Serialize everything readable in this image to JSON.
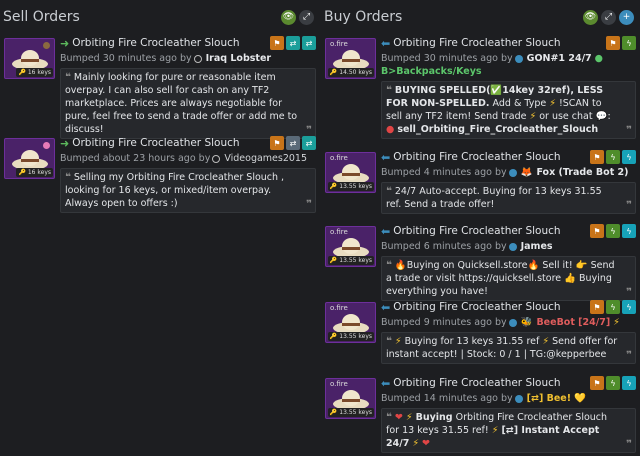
{
  "sell": {
    "title": "Sell Orders",
    "icons": [
      "eye-icon",
      "expand-icon"
    ],
    "listings": [
      {
        "item_name": "Orbiting Fire Crocleather Slouch",
        "price_tag": "16 keys",
        "bumped": "Bumped 30 minutes ago by",
        "user": "Iraq Lobster",
        "comment": "Mainly looking for pure or reasonable item overpay. I can also sell for cash on any TF2 marketplace. Prices are always negotiable for pure, feel free to send a trade offer or add me to discuss!"
      },
      {
        "item_name": "Orbiting Fire Crocleather Slouch",
        "price_tag": "16 keys",
        "bumped": "Bumped about 23 hours ago by",
        "user": "Videogames2015",
        "comment": "Selling my Orbiting Fire Crocleather Slouch , looking for 16 keys, or mixed/item overpay. Always open to offers :)"
      }
    ]
  },
  "buy": {
    "title": "Buy Orders",
    "icons": [
      "eye-icon",
      "expand-icon",
      "plus-icon"
    ],
    "listings": [
      {
        "item_name": "Orbiting Fire Crocleather Slouch",
        "card_label": "o.fire",
        "price_tag": "14.50 keys",
        "bumped": "Bumped 30 minutes ago by",
        "user": "GON#1 24/7",
        "user2": "B>Backpacks/Keys",
        "comment_a": "BUYING SPELLED(",
        "comment_b": "14key 32ref), LESS FOR NON-SPELLED.",
        "comment_c": "Add & Type",
        "comment_d": "!SCAN to sell any TF2 item! Send trade",
        "comment_e": "or  use  chat",
        "comment_f": ":",
        "comment_g": "sell_Orbiting_Fire_Crocleather_Slouch"
      },
      {
        "item_name": "Orbiting Fire Crocleather Slouch",
        "card_label": "o.fire",
        "price_tag": "13.55 keys",
        "bumped": "Bumped 4 minutes ago by",
        "user": "Fox (Trade Bot 2)",
        "comment": "24/7 Auto-accept. Buying for 13 keys 31.55 ref. Send a trade offer!"
      },
      {
        "item_name": "Orbiting Fire Crocleather Slouch",
        "card_label": "o.fire",
        "price_tag": "13.55 keys",
        "bumped": "Bumped 6 minutes ago by",
        "user": "James",
        "comment_a": "Buying on Quicksell.store",
        "comment_b": "Sell it!",
        "comment_c": "Send a trade or visit https://quicksell.store",
        "comment_d": "Buying everything you have!"
      },
      {
        "item_name": "Orbiting Fire Crocleather Slouch",
        "card_label": "o.fire",
        "price_tag": "13.55 keys",
        "bumped": "Bumped 9 minutes ago by",
        "user": "BeeBot [24/7]",
        "comment_a": "Buying for 13 keys 31.55 ref",
        "comment_b": "Send offer for instant accept! | Stock: 0 / 1 | TG:@kepperbee"
      },
      {
        "item_name": "Orbiting Fire Crocleather Slouch",
        "card_label": "o.fire",
        "price_tag": "13.55 keys",
        "bumped": "Bumped 14 minutes ago by",
        "user": "[⇄] Bee!",
        "comment_a": "Buying",
        "comment_b": "Orbiting Fire Crocleather Slouch for 13 keys 31.55 ref!",
        "comment_c": "[⇄] Instant Accept 24/7"
      }
    ]
  }
}
